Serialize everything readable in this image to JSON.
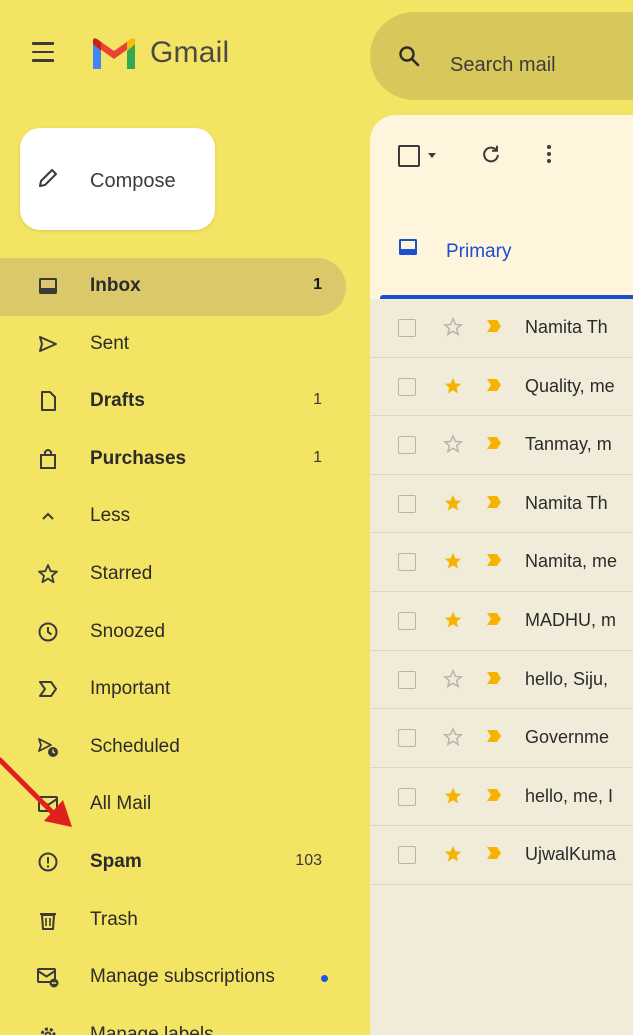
{
  "header": {
    "brand": "Gmail",
    "search_placeholder": "Search mail"
  },
  "compose": {
    "label": "Compose"
  },
  "sidebar": {
    "items": [
      {
        "label": "Inbox",
        "count": "1",
        "icon": "inbox-icon",
        "bold": true,
        "active": true
      },
      {
        "label": "Sent",
        "count": "",
        "icon": "send-icon"
      },
      {
        "label": "Drafts",
        "count": "1",
        "icon": "draft-icon",
        "bold": true
      },
      {
        "label": "Purchases",
        "count": "1",
        "icon": "purchase-icon",
        "bold": true
      },
      {
        "label": "Less",
        "count": "",
        "icon": "chevron-up-icon"
      },
      {
        "label": "Starred",
        "count": "",
        "icon": "star-icon"
      },
      {
        "label": "Snoozed",
        "count": "",
        "icon": "clock-icon"
      },
      {
        "label": "Important",
        "count": "",
        "icon": "important-icon"
      },
      {
        "label": "Scheduled",
        "count": "",
        "icon": "scheduled-send-icon"
      },
      {
        "label": "All Mail",
        "count": "",
        "icon": "all-mail-icon"
      },
      {
        "label": "Spam",
        "count": "103",
        "icon": "spam-icon",
        "bold": true
      },
      {
        "label": "Trash",
        "count": "",
        "icon": "trash-icon"
      },
      {
        "label": "Manage subscriptions",
        "count": "",
        "icon": "unsubscribe-icon",
        "dot": true
      },
      {
        "label": "Manage labels",
        "count": "",
        "icon": "gear-icon"
      }
    ]
  },
  "main": {
    "tab_primary": "Primary",
    "rows": [
      {
        "sender": "Namita Th",
        "starred": false
      },
      {
        "sender": "Quality, me",
        "starred": true
      },
      {
        "sender": "Tanmay, m",
        "starred": false
      },
      {
        "sender": "Namita Th",
        "starred": true
      },
      {
        "sender": "Namita, me",
        "starred": true
      },
      {
        "sender": "MADHU, m",
        "starred": true
      },
      {
        "sender": "hello, Siju,",
        "starred": false
      },
      {
        "sender": "Governme",
        "starred": false
      },
      {
        "sender": "hello, me, I",
        "starred": true
      },
      {
        "sender": "UjwalKuma",
        "starred": true
      }
    ]
  },
  "colors": {
    "background": "#f4e463",
    "accent": "#1b4fd1",
    "star": "#f5b400",
    "annotation_arrow": "#e0201d"
  }
}
